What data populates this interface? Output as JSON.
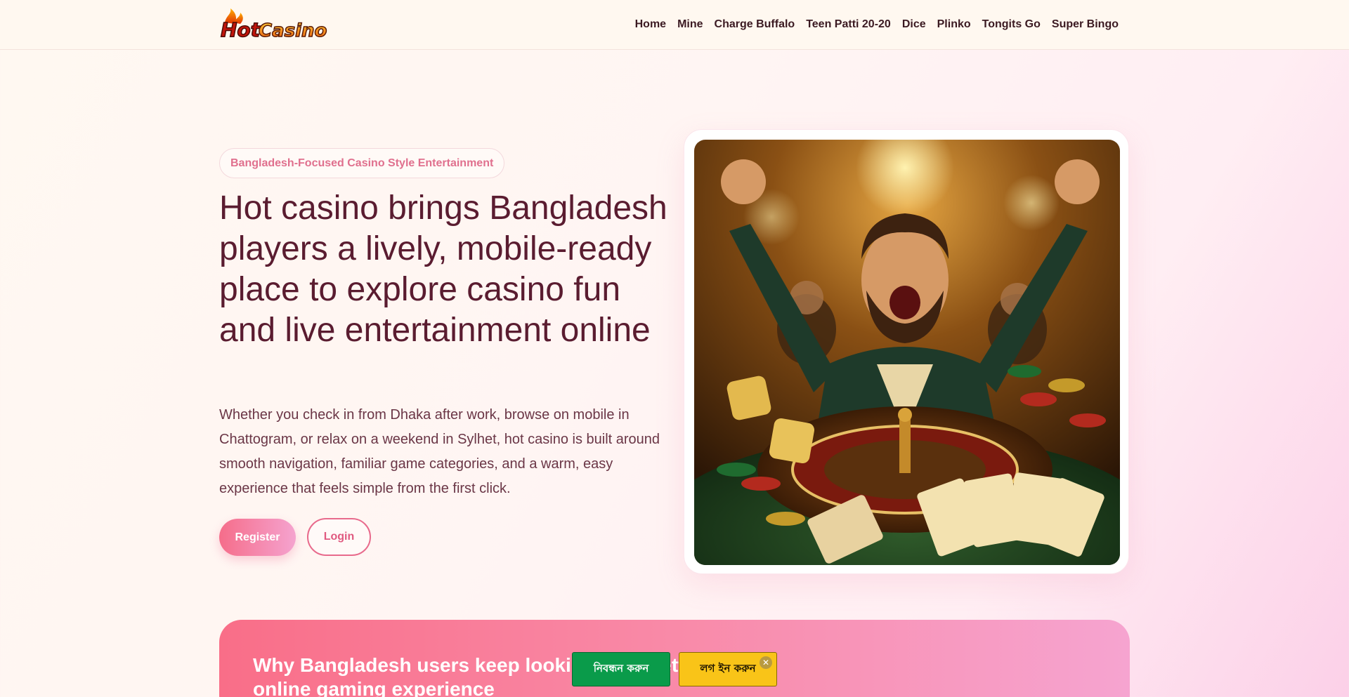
{
  "header": {
    "logo_text": "HotCasino",
    "nav": [
      "Home",
      "Mine",
      "Charge Buffalo",
      "Teen Patti 20-20",
      "Dice",
      "Plinko",
      "Tongits Go",
      "Super Bingo"
    ]
  },
  "hero": {
    "badge": "Bangladesh-Focused Casino Style Entertainment",
    "title": "Hot casino brings Bangladesh players a lively, mobile-ready place to explore casino fun and live entertainment online",
    "description": "Whether you check in from Dhaka after work, browse on mobile in Chattogram, or relax on a weekend in Sylhet, hot casino is built around smooth navigation, familiar game categories, and a warm, easy experience that feels simple from the first click.",
    "register_label": "Register",
    "login_label": "Login"
  },
  "why": {
    "title": "Why Bangladesh users keep looking for a better online gaming experience"
  },
  "floating": {
    "register_label": "নিবন্ধন করুন",
    "login_label": "লগ ইন করুন",
    "close_glyph": "✕"
  },
  "colors": {
    "accent_pink": "#f56d8a",
    "float_green": "#0a9b4a",
    "float_yellow": "#f9c418"
  }
}
